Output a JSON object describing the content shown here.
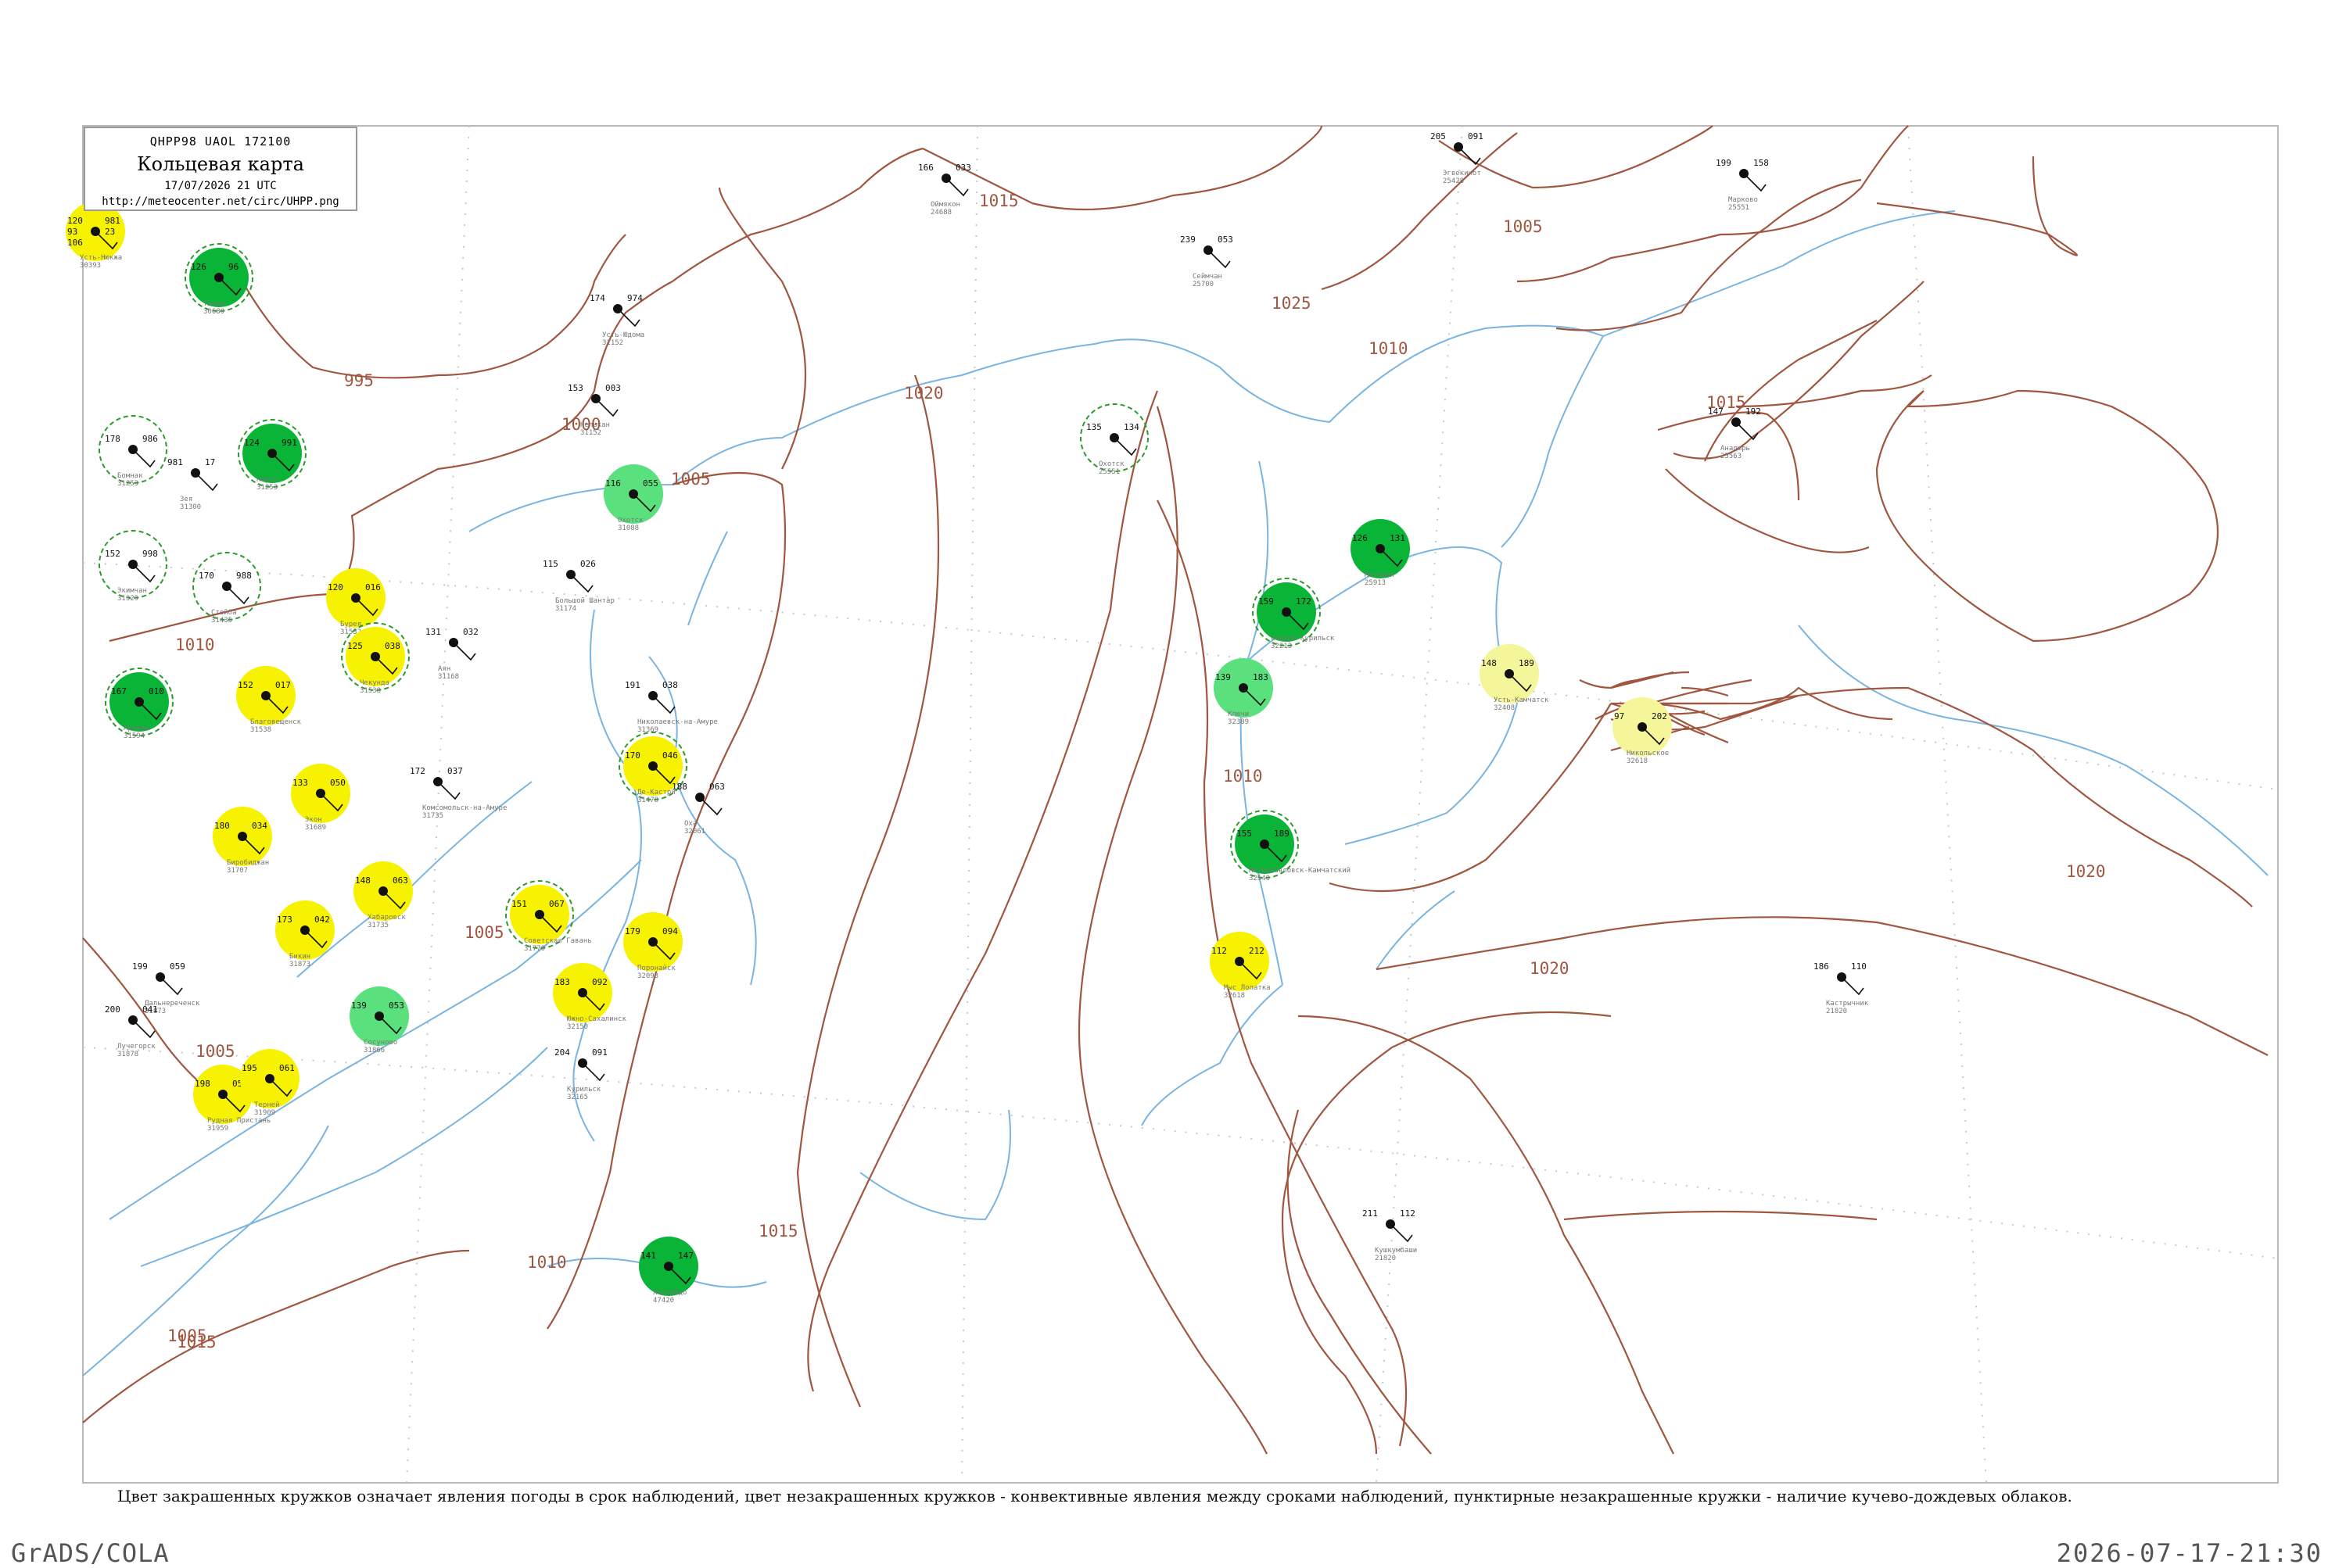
{
  "header": {
    "code": "QHPP98  UAOL  172100",
    "title": "Кольцевая карта",
    "date": "17/07/2026 21 UTC",
    "url": "http://meteocenter.net/circ/UHPP.png"
  },
  "isobar_labels": [
    "995",
    "1000",
    "1005",
    "1010",
    "1015",
    "1020",
    "1025",
    "1005",
    "1010",
    "1015",
    "1010",
    "1015",
    "1020",
    "1020",
    "1010",
    "1015",
    "1005",
    "1005",
    "1005"
  ],
  "stations": [
    {
      "name": "Усть-Нюкжа",
      "id": "30393",
      "wx": "yellow",
      "ring": false,
      "left": "120",
      "left2": "93",
      "left3": "106",
      "right": "981",
      "right2": "23"
    },
    {
      "name": "Тында",
      "id": "30680",
      "wx": "green",
      "ring": true,
      "left": "126",
      "right": "96"
    },
    {
      "name": "Зея",
      "id": "31300",
      "wx": "none",
      "ring": false,
      "left": "981",
      "right": "17"
    },
    {
      "name": "Норск",
      "id": "31253",
      "wx": "green",
      "ring": true,
      "left": "124",
      "right": "991"
    },
    {
      "name": "Бомнак",
      "id": "31253",
      "wx": "none",
      "ring": true,
      "left": "178",
      "right": "986"
    },
    {
      "name": "Экимчан",
      "id": "31329",
      "wx": "none",
      "ring": true,
      "left": "152",
      "right": "998"
    },
    {
      "name": "Стойба",
      "id": "31435",
      "wx": "none",
      "ring": true,
      "left": "170",
      "right": "988"
    },
    {
      "name": "Бурея",
      "id": "31532",
      "wx": "yellow",
      "ring": false,
      "left": "120",
      "right": "016"
    },
    {
      "name": "Чекунда",
      "id": "31538",
      "wx": "yellow",
      "ring": true,
      "left": "125",
      "right": "038"
    },
    {
      "name": "Благовещенск",
      "id": "31538",
      "wx": "yellow",
      "ring": false,
      "left": "152",
      "right": "017"
    },
    {
      "name": "Архара",
      "id": "31594",
      "wx": "green",
      "ring": true,
      "left": "167",
      "right": "010"
    },
    {
      "name": "Экон",
      "id": "31689",
      "wx": "yellow",
      "ring": false,
      "left": "133",
      "right": "050"
    },
    {
      "name": "Биробиджан",
      "id": "31707",
      "wx": "yellow",
      "ring": false,
      "left": "180",
      "right": "034"
    },
    {
      "name": "Хабаровск",
      "id": "31735",
      "wx": "yellow",
      "ring": false,
      "left": "148",
      "right": "063"
    },
    {
      "name": "Бикин",
      "id": "31873",
      "wx": "yellow",
      "ring": false,
      "left": "173",
      "right": "042"
    },
    {
      "name": "Дальнереченск",
      "id": "31873",
      "wx": "none",
      "ring": false,
      "left": "199",
      "right": "059"
    },
    {
      "name": "Лучегорск",
      "id": "31878",
      "wx": "none",
      "ring": false,
      "left": "200",
      "right": "041"
    },
    {
      "name": "Рудная Пристань",
      "id": "31959",
      "wx": "yellow",
      "ring": false,
      "left": "198",
      "right": "058"
    },
    {
      "name": "Терней",
      "id": "31909",
      "wx": "yellow",
      "ring": false,
      "left": "195",
      "right": "061"
    },
    {
      "name": "Сосуново",
      "id": "31866",
      "wx": "lightgreen",
      "ring": false,
      "left": "139",
      "right": "053"
    },
    {
      "name": "Усть-Юдома",
      "id": "31152",
      "wx": "none",
      "ring": false,
      "left": "174",
      "right": "974"
    },
    {
      "name": "Нелькан",
      "id": "31152",
      "wx": "none",
      "ring": false,
      "left": "153",
      "right": "003"
    },
    {
      "name": "Охотск",
      "id": "31088",
      "wx": "lightgreen",
      "ring": false,
      "left": "116",
      "right": "055"
    },
    {
      "name": "Большой Шантар",
      "id": "31174",
      "wx": "none",
      "ring": false,
      "left": "115",
      "right": "026"
    },
    {
      "name": "Аян",
      "id": "31168",
      "wx": "none",
      "ring": false,
      "left": "131",
      "right": "032"
    },
    {
      "name": "Николаевск-на-Амуре",
      "id": "31369",
      "wx": "none",
      "ring": false,
      "left": "191",
      "right": "038"
    },
    {
      "name": "Комсомольск-на-Амуре",
      "id": "31735",
      "wx": "none",
      "ring": false,
      "left": "172",
      "right": "037"
    },
    {
      "name": "Де-Кастри",
      "id": "31478",
      "wx": "yellow",
      "ring": true,
      "left": "170",
      "right": "046"
    },
    {
      "name": "Охa",
      "id": "32061",
      "wx": "none",
      "ring": false,
      "left": "188",
      "right": "063"
    },
    {
      "name": "Советская Гавань",
      "id": "31770",
      "wx": "yellow",
      "ring": true,
      "left": "151",
      "right": "067"
    },
    {
      "name": "Поронайск",
      "id": "32098",
      "wx": "yellow",
      "ring": false,
      "left": "179",
      "right": "094"
    },
    {
      "name": "Южно-Сахалинск",
      "id": "32150",
      "wx": "yellow",
      "ring": false,
      "left": "183",
      "right": "092"
    },
    {
      "name": "Курильск",
      "id": "32165",
      "wx": "none",
      "ring": false,
      "left": "204",
      "right": "091"
    },
    {
      "name": "Хоккайдо",
      "id": "47420",
      "wx": "green",
      "ring": false,
      "left": "141",
      "right": "147"
    },
    {
      "name": "Охотск",
      "id": "25551",
      "wx": "none",
      "ring": true,
      "left": "135",
      "right": "134"
    },
    {
      "name": "Магадан",
      "id": "25913",
      "wx": "green",
      "ring": false,
      "left": "126",
      "right": "131"
    },
    {
      "name": "Северо-Курильск",
      "id": "32213",
      "wx": "green",
      "ring": true,
      "left": "159",
      "right": "172"
    },
    {
      "name": "Ключи",
      "id": "32389",
      "wx": "lightgreen",
      "ring": false,
      "left": "139",
      "right": "183"
    },
    {
      "name": "Петропавловск-Камчатский",
      "id": "32540",
      "wx": "green",
      "ring": true,
      "left": "155",
      "right": "189"
    },
    {
      "name": "Мыс Лопатка",
      "id": "32618",
      "wx": "yellow",
      "ring": false,
      "left": "112",
      "right": "212"
    },
    {
      "name": "Усть-Камчатск",
      "id": "32408",
      "wx": "lightyellow",
      "ring": false,
      "left": "148",
      "right": "189"
    },
    {
      "name": "Никольское",
      "id": "32618",
      "wx": "lightyellow",
      "ring": false,
      "left": "97",
      "right": "202"
    },
    {
      "name": "Анадырь",
      "id": "25563",
      "wx": "none",
      "ring": false,
      "left": "147",
      "right": "192"
    },
    {
      "name": "Марково",
      "id": "25551",
      "wx": "none",
      "ring": false,
      "left": "199",
      "right": "158"
    },
    {
      "name": "Эгвекинот",
      "id": "25428",
      "wx": "none",
      "ring": false,
      "left": "205",
      "right": "091"
    },
    {
      "name": "Сеймчан",
      "id": "25700",
      "wx": "none",
      "ring": false,
      "left": "239",
      "right": "053"
    },
    {
      "name": "Оймякон",
      "id": "24688",
      "wx": "none",
      "ring": false,
      "left": "166",
      "right": "033"
    },
    {
      "name": "Кастрычник",
      "id": "21820",
      "wx": "none",
      "ring": false,
      "left": "186",
      "right": "110"
    },
    {
      "name": "Кушкумбаши",
      "id": "21820",
      "wx": "none",
      "ring": false,
      "left": "211",
      "right": "112"
    }
  ],
  "footnote": "Цвет закрашенных кружков означает явления погоды в срок наблюдений, цвет незакрашенных кружков - конвективные явления между сроками наблюдений, пунктирные незакрашенные кружки - наличие кучево-дождевых облаков.",
  "footer": {
    "left": "GrADS/COLA",
    "right": "2026-07-17-21:30"
  },
  "colors": {
    "coast": "#7ab4e0",
    "isobar": "#a0563f",
    "green": "#0ab437",
    "lightgreen": "#5ae07d",
    "yellow": "#f7f200",
    "lightyellow": "#f5f59a",
    "ring": "#2c9b2c"
  }
}
